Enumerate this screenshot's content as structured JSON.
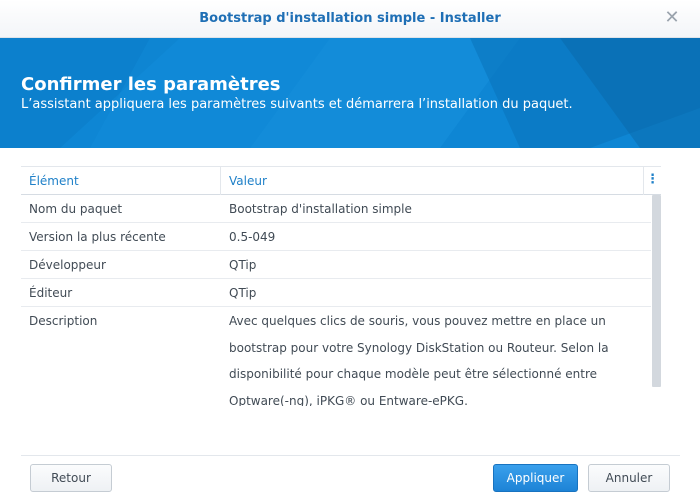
{
  "window": {
    "title": "Bootstrap d'installation simple - Installer"
  },
  "banner": {
    "heading": "Confirmer les paramètres",
    "subheading": "L’assistant appliquera les paramètres suivants et démarrera l’installation du paquet."
  },
  "table": {
    "columns": [
      "Élément",
      "Valeur"
    ],
    "rows": [
      {
        "key": "Nom du paquet",
        "value": "Bootstrap d'installation simple"
      },
      {
        "key": "Version la plus récente",
        "value": "0.5-049"
      },
      {
        "key": "Développeur",
        "value": "QTip"
      },
      {
        "key": "Éditeur",
        "value": "QTip"
      },
      {
        "key": "Description",
        "value_lines": [
          "Avec quelques clics de souris, vous pouvez mettre en place un",
          "bootstrap pour votre Synology DiskStation ou Routeur. Selon la",
          "disponibilité pour chaque modèle peut être sélectionné entre",
          "Optware(-ng), iPKG® ou Entware-ePKG."
        ]
      }
    ]
  },
  "buttons": {
    "back": "Retour",
    "apply": "Appliquer",
    "cancel": "Annuler"
  },
  "colors": {
    "accent": "#0e86d4",
    "title": "#1f6fb5",
    "header_text": "#1f80c8"
  },
  "icons": {
    "close": "close-icon",
    "column_menu": "vertical-ellipsis-icon"
  }
}
